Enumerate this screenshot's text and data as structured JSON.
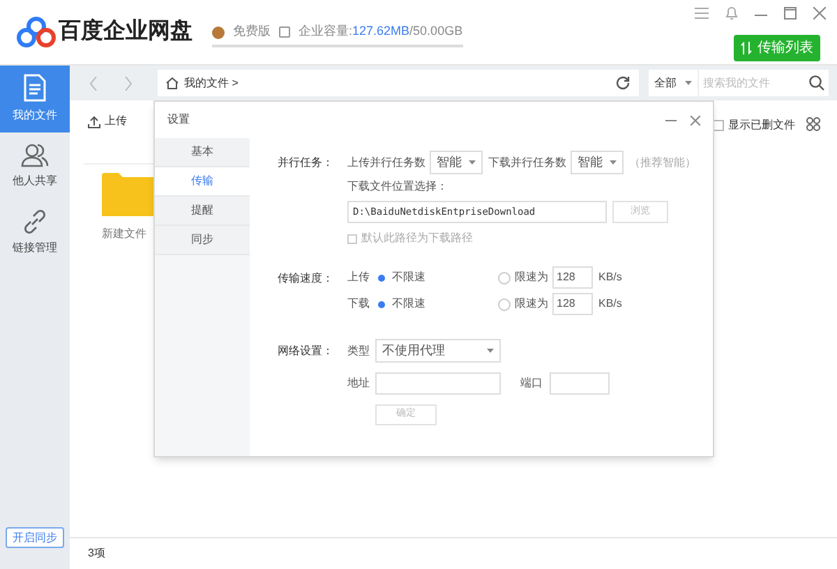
{
  "app": {
    "name": "百度企业网盘",
    "edition": "免费版",
    "quota_label": "企业容量:",
    "quota_used": "127.62MB",
    "quota_total": "/50.00GB",
    "transfer_button": "传输列表"
  },
  "sidebar": {
    "items": [
      {
        "label": "我的文件",
        "selected": true
      },
      {
        "label": "他人共享",
        "selected": false
      },
      {
        "label": "链接管理",
        "selected": false
      }
    ],
    "sync_button": "开启同步"
  },
  "toolbar": {
    "path": "我的文件 >",
    "filter": "全部",
    "search": {
      "placeholder": "搜索我的文件"
    }
  },
  "content": {
    "upload": "上传",
    "show_deleted": {
      "label": "显示已删文件",
      "checked": false
    },
    "files": [
      {
        "name": "新建文件"
      }
    ],
    "status": "3项"
  },
  "dialog": {
    "title": "设置",
    "tabs": [
      {
        "label": "基本",
        "selected": false
      },
      {
        "label": "传输",
        "selected": true
      },
      {
        "label": "提醒",
        "selected": false
      },
      {
        "label": "同步",
        "selected": false
      }
    ],
    "parallel": {
      "label": "并行任务：",
      "upload_label": "上传并行任务数",
      "upload_value": "智能",
      "download_label": "下载并行任务数",
      "download_value": "智能",
      "hint": "（推荐智能）"
    },
    "download_path": {
      "label": "下载文件位置选择：",
      "value": "D:\\BaiduNetdiskEntpriseDownload",
      "browse": "浏览",
      "default_checkbox": {
        "label": "默认此路径为下载路径",
        "checked": false
      }
    },
    "speed": {
      "label": "传输速度：",
      "rows": [
        {
          "label": "上传",
          "unlimited": "不限速",
          "limited": "限速为",
          "value": "128",
          "unit": "KB/s",
          "unlimited_selected": true
        },
        {
          "label": "下载",
          "unlimited": "不限速",
          "limited": "限速为",
          "value": "128",
          "unit": "KB/s",
          "unlimited_selected": true
        }
      ]
    },
    "network": {
      "label": "网络设置：",
      "type_label": "类型",
      "type_value": "不使用代理",
      "address_label": "地址",
      "port_label": "端口",
      "confirm": "确定"
    }
  }
}
